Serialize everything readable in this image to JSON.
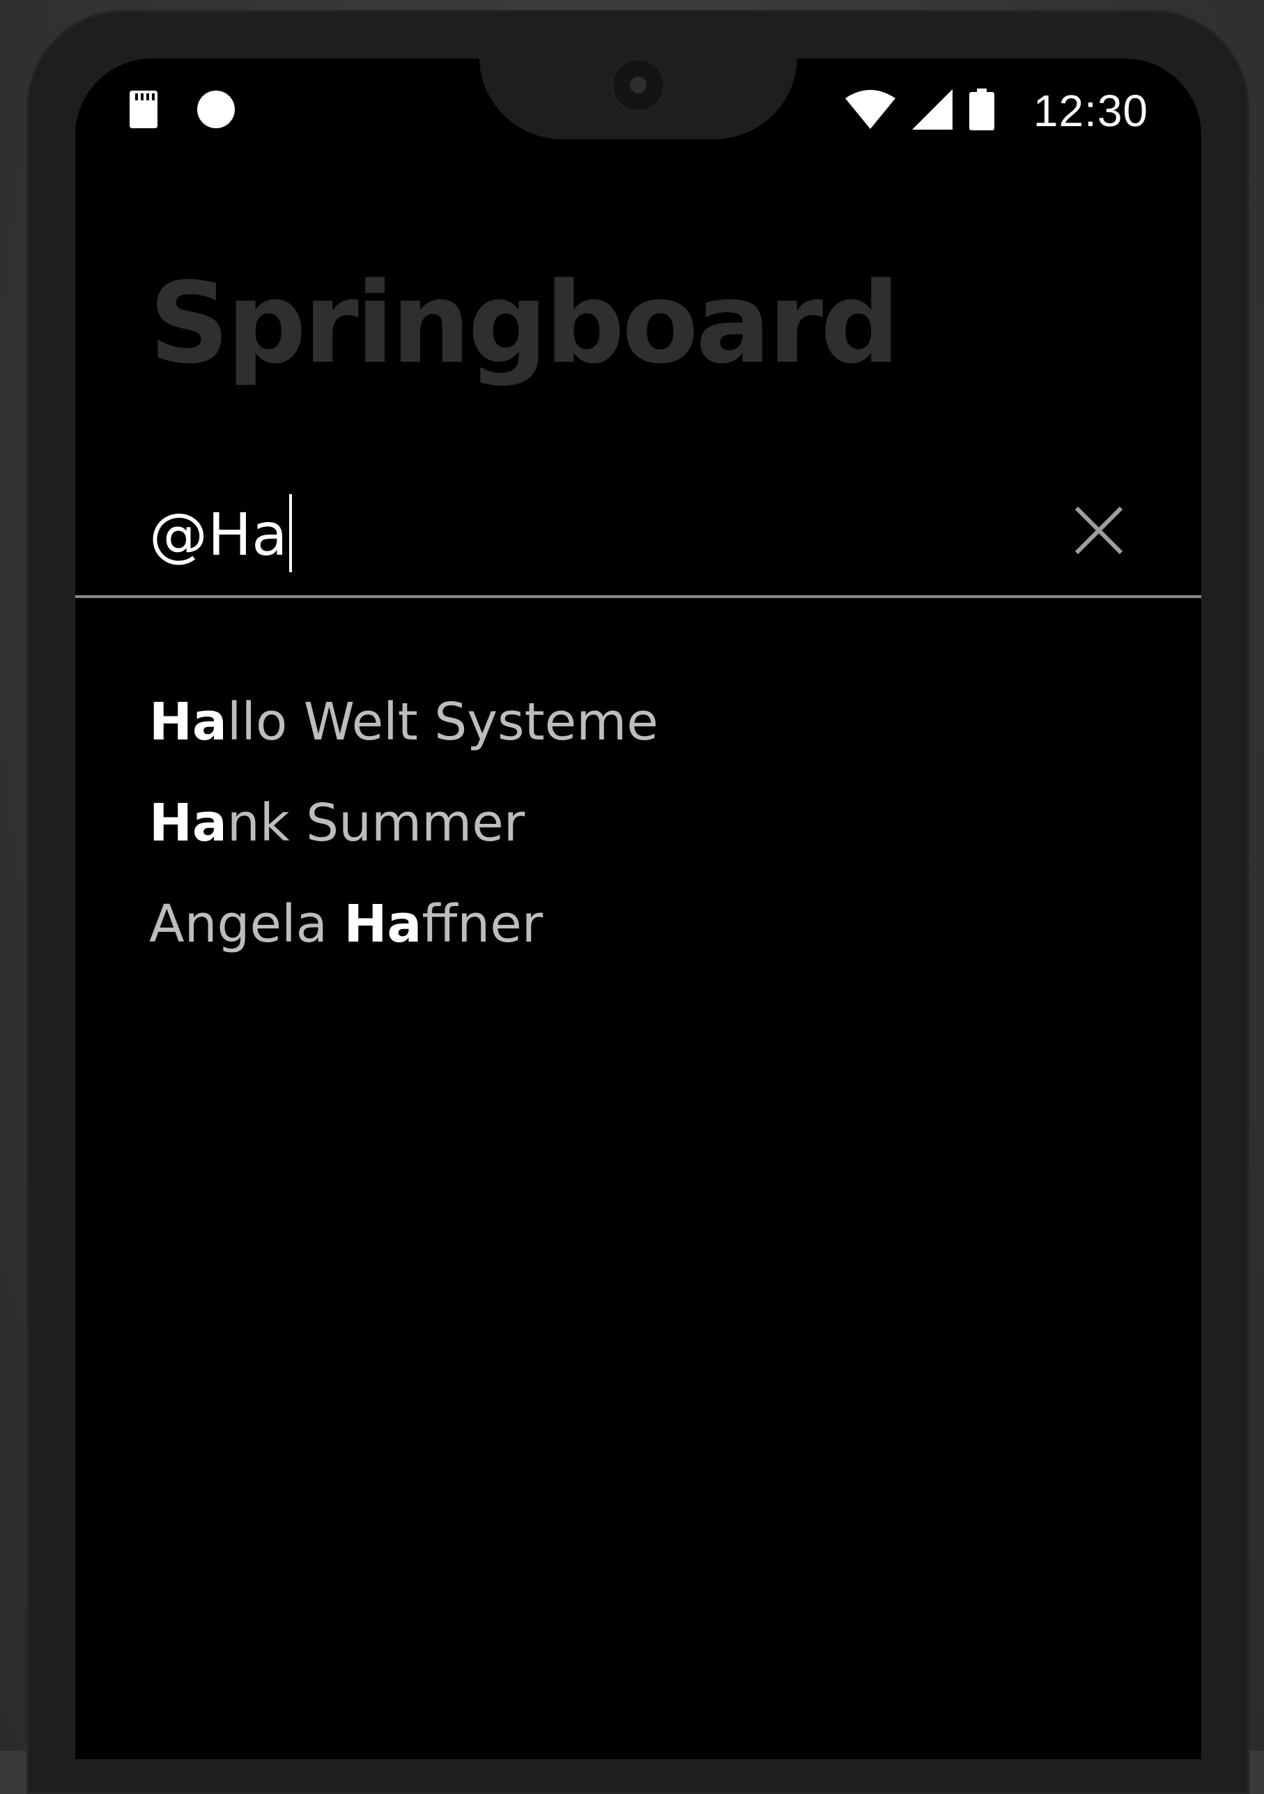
{
  "status_bar": {
    "time": "12:30",
    "left_icons": [
      "sd-card-icon",
      "notification-dot-icon"
    ],
    "right_icons": [
      "wifi-icon",
      "signal-icon",
      "battery-icon"
    ]
  },
  "app": {
    "title": "Springboard"
  },
  "search": {
    "value": "@Ha",
    "clear_icon": "close-icon"
  },
  "suggestions": [
    {
      "highlight_before": "",
      "highlight": "Ha",
      "after": "llo Welt Systeme",
      "prefix": ""
    },
    {
      "highlight_before": "",
      "highlight": "Ha",
      "after": "nk Summer",
      "prefix": ""
    },
    {
      "highlight_before": "Angela ",
      "highlight": "Ha",
      "after": "ffner",
      "prefix": ""
    }
  ],
  "colors": {
    "background": "#000000",
    "title": "#2f2f2f",
    "text": "#bdbdbd",
    "highlight": "#ffffff",
    "divider": "#8a8a8a"
  }
}
